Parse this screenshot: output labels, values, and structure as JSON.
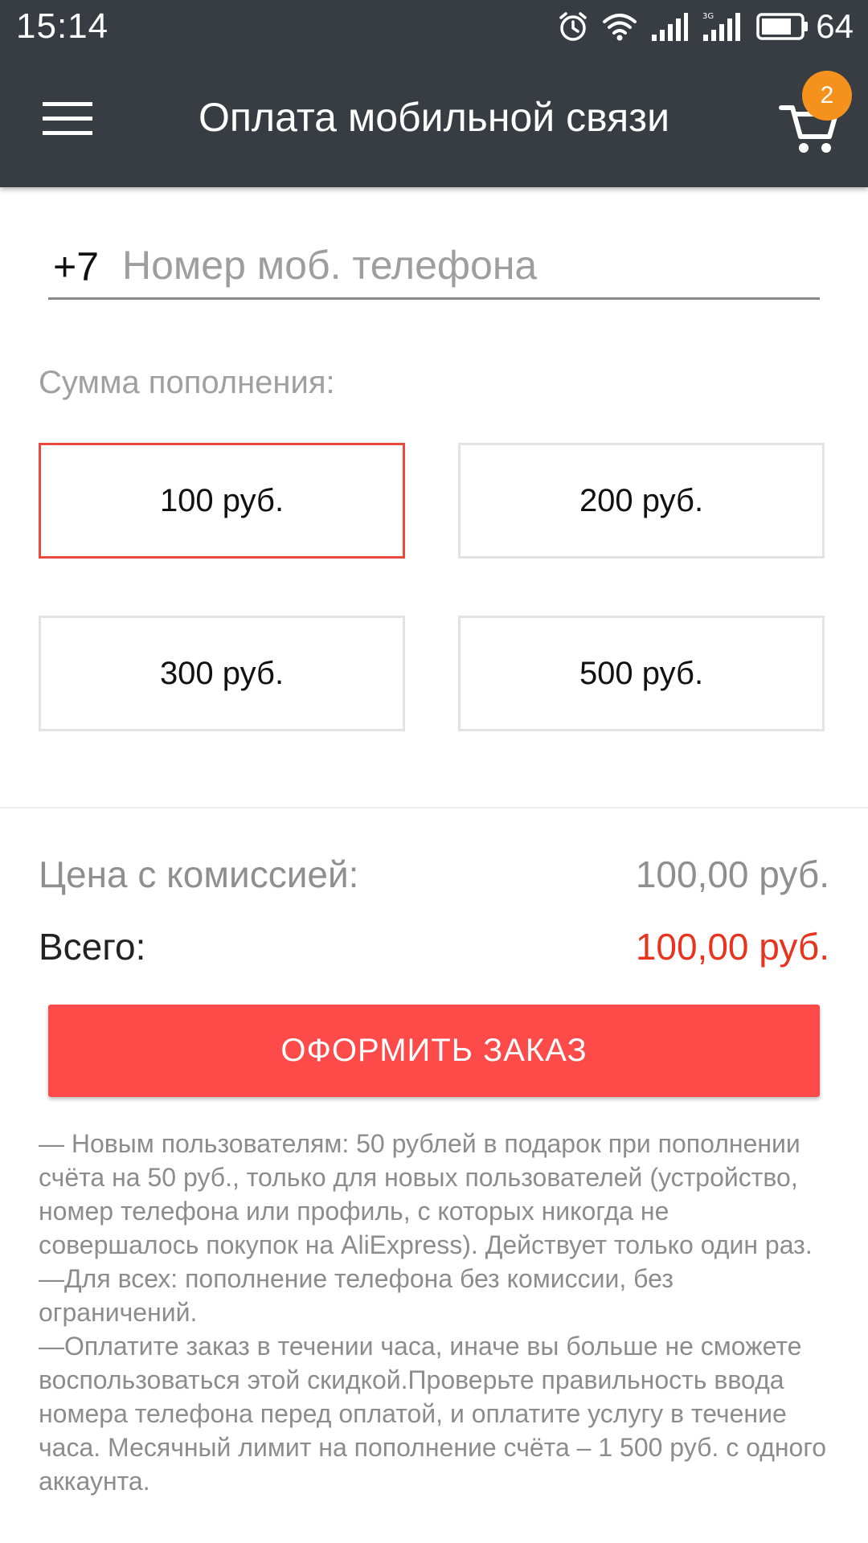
{
  "status_bar": {
    "time": "15:14",
    "battery_level": "64",
    "icons": [
      "alarm-icon",
      "wifi-icon",
      "signal-icon",
      "3g-signal-icon",
      "battery-icon"
    ]
  },
  "app_bar": {
    "title": "Оплата мобильной связи",
    "menu_icon": "hamburger-menu-icon",
    "cart_icon": "shopping-cart-icon",
    "cart_count": "2"
  },
  "phone": {
    "prefix": "+7",
    "value": "",
    "placeholder": "Номер моб. телефона"
  },
  "amount": {
    "label": "Сумма пополнения:",
    "options": [
      "100 руб.",
      "200 руб.",
      "300 руб.",
      "500 руб."
    ],
    "selected": "100 руб."
  },
  "summary": {
    "price_label": "Цена с комиссией:",
    "price_value": "100,00 руб.",
    "total_label": "Всего:",
    "total_value": "100,00 руб."
  },
  "order_button": "ОФОРМИТЬ ЗАКАЗ",
  "notes": [
    "— Новым пользователям: 50 рублей в подарок при пополнении счёта на 50 руб., только для новых пользователей (устройство, номер телефона или профиль, с которых никогда не совершалось покупок на AliExpress). Действует только один раз.",
    "—Для всех: пополнение телефона без комиссии, без ограничений.",
    "—Оплатите заказ в течении часа, иначе вы больше не сможете воспользоваться этой скидкой.Проверьте правильность ввода номера телефона перед оплатой, и оплатите услугу в течение часа. Месячный лимит на пополнение счёта – 1 500 руб. с одного аккаунта."
  ],
  "colors": {
    "header_bg": "#373d42",
    "accent_red": "#ff4a4a",
    "total_red": "#e8331f",
    "badge_orange": "#f5921e",
    "selected_border": "#e84a3f"
  }
}
